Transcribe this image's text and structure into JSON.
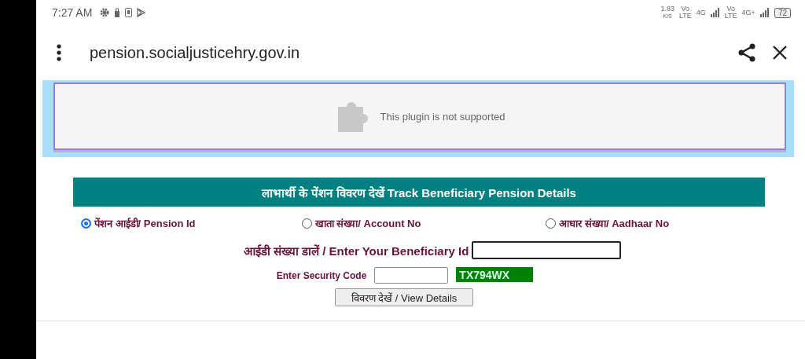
{
  "status_bar": {
    "time": "7:27 AM",
    "speed": "1.83",
    "speed_unit": "K/S",
    "sim1_volte": [
      "Vo",
      "LTE"
    ],
    "sim1_network": "4G",
    "sim2_volte": [
      "Vo",
      "LTE"
    ],
    "sim2_network": "4G+",
    "battery": "72"
  },
  "browser": {
    "url": "pension.socialjusticehry.gov.in"
  },
  "plugin": {
    "message": "This plugin is not supported"
  },
  "form": {
    "heading": "लाभार्थी के पेंशन विवरण देखें  Track Beneficiary Pension Details",
    "options": [
      {
        "label": "पेंशन आईडी/ Pension Id",
        "selected": true
      },
      {
        "label": "खाता संख्या/ Account No",
        "selected": false
      },
      {
        "label": "आधार संख्या/ Aadhaar No",
        "selected": false
      }
    ],
    "id_label": "आईडी संख्या डालें / Enter Your Beneficiary Id",
    "security_label": "Enter Security Code",
    "captcha": "TX794WX",
    "submit": "विवरण देखें / View Details"
  }
}
